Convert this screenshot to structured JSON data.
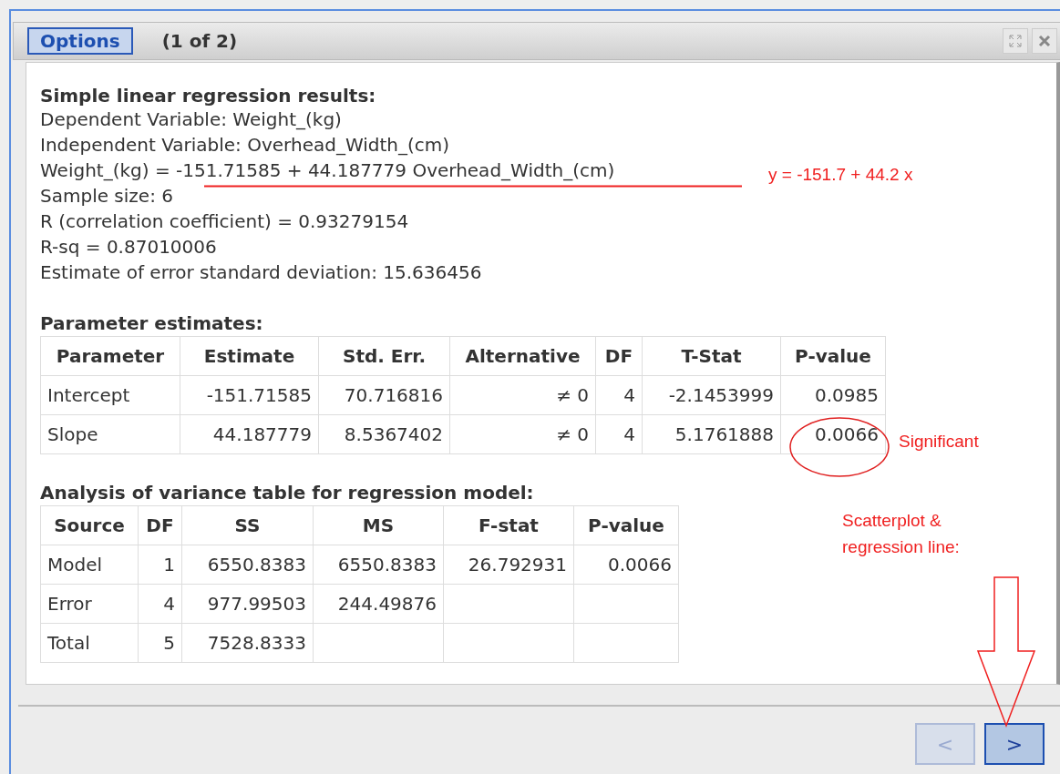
{
  "header": {
    "options_button": "Options",
    "page_indicator": "(1 of 2)"
  },
  "results": {
    "title": "Simple linear regression results:",
    "lines_before": [
      "Dependent Variable: Weight_(kg)",
      "Independent Variable: Overhead_Width_(cm)"
    ],
    "equation": "Weight_(kg) = -151.71585 + 44.187779 Overhead_Width_(cm)",
    "lines_after": [
      "Sample size: 6",
      "R (correlation coefficient) = 0.93279154",
      "R-sq = 0.87010006",
      "Estimate of error standard deviation: 15.636456"
    ]
  },
  "parameter_table": {
    "title": "Parameter estimates:",
    "columns": [
      "Parameter",
      "Estimate",
      "Std. Err.",
      "Alternative",
      "DF",
      "T-Stat",
      "P-value"
    ],
    "rows": [
      [
        "Intercept",
        "-151.71585",
        "70.716816",
        "≠ 0",
        "4",
        "-2.1453999",
        "0.0985"
      ],
      [
        "Slope",
        "44.187779",
        "8.5367402",
        "≠ 0",
        "4",
        "5.1761888",
        "0.0066"
      ]
    ]
  },
  "anova_table": {
    "title": "Analysis of variance table for regression model:",
    "columns": [
      "Source",
      "DF",
      "SS",
      "MS",
      "F-stat",
      "P-value"
    ],
    "rows": [
      [
        "Model",
        "1",
        "6550.8383",
        "6550.8383",
        "26.792931",
        "0.0066"
      ],
      [
        "Error",
        "4",
        "977.99503",
        "244.49876"
      ],
      [
        "Total",
        "5",
        "7528.8333"
      ]
    ]
  },
  "annotations": {
    "equation_note": "y = -151.7 +  44.2 x",
    "significance_note": "Significant",
    "scatterplot_note": [
      "Scatterplot  &",
      "regression line:"
    ]
  },
  "navigation": [
    {
      "label": "<",
      "disabled": true
    },
    {
      "label": ">",
      "disabled": false
    }
  ]
}
